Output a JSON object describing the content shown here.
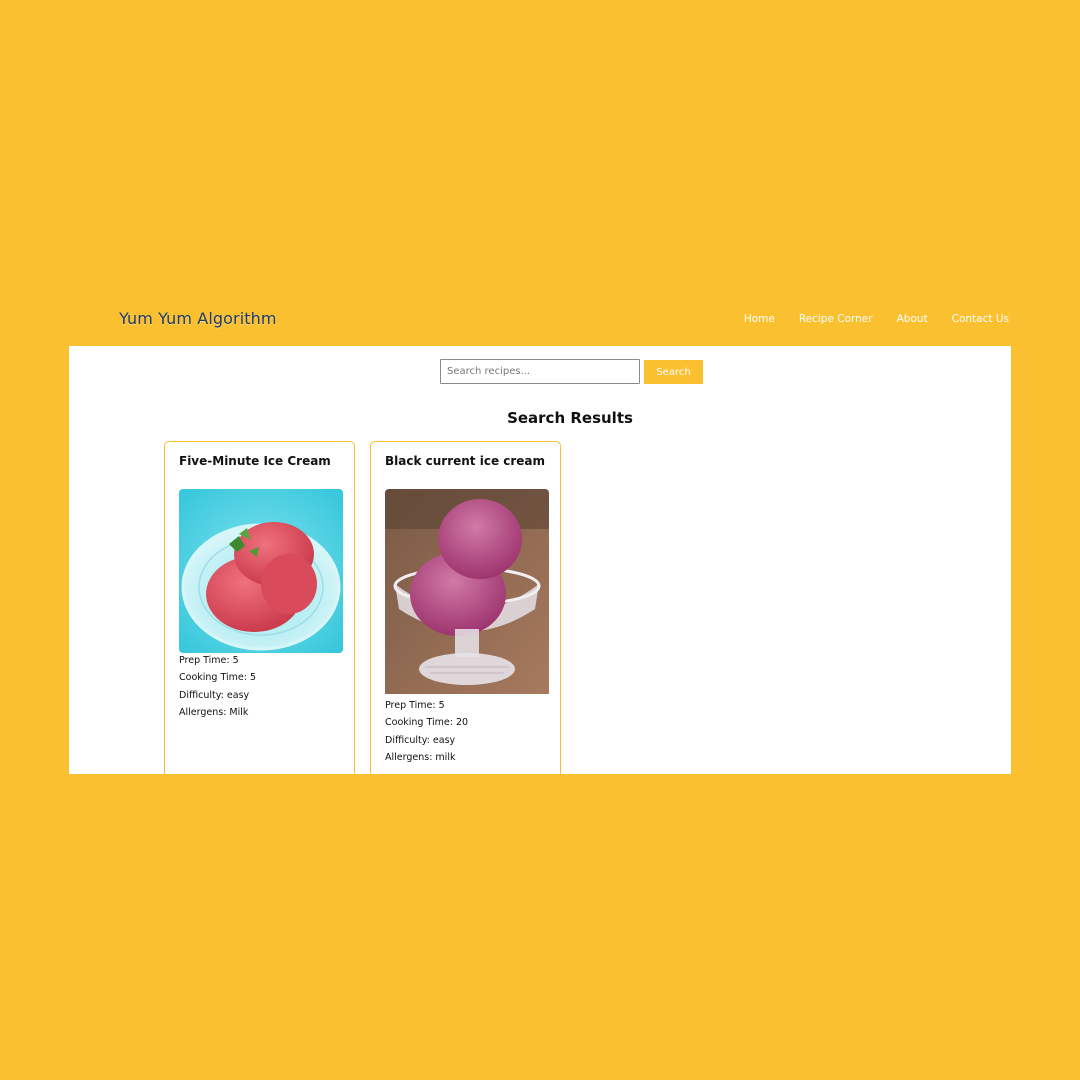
{
  "brand": {
    "name": "Yum Yum Algorithm",
    "color": "#1f3a6b"
  },
  "nav": {
    "items": [
      {
        "label": "Home"
      },
      {
        "label": "Recipe Corner"
      },
      {
        "label": "About"
      },
      {
        "label": "Contact Us"
      }
    ]
  },
  "search": {
    "placeholder": "Search recipes...",
    "value": "",
    "button_label": "Search"
  },
  "results": {
    "title": "Search Results",
    "recipes": [
      {
        "title": "Five-Minute Ice Cream",
        "image_icon": "ice-cream-photo",
        "prep_time": "Prep Time: 5",
        "cooking_time": "Cooking Time: 5",
        "difficulty": "Difficulty: easy",
        "allergens": "Allergens: Milk"
      },
      {
        "title": "Black current ice cream",
        "image_icon": "ice-cream-photo",
        "prep_time": "Prep Time: 5",
        "cooking_time": "Cooking Time: 20",
        "difficulty": "Difficulty: easy",
        "allergens": "Allergens: milk"
      }
    ]
  },
  "colors": {
    "accent": "#FBC02F",
    "background": "#FBC02F",
    "panel": "#FFFFFF"
  }
}
